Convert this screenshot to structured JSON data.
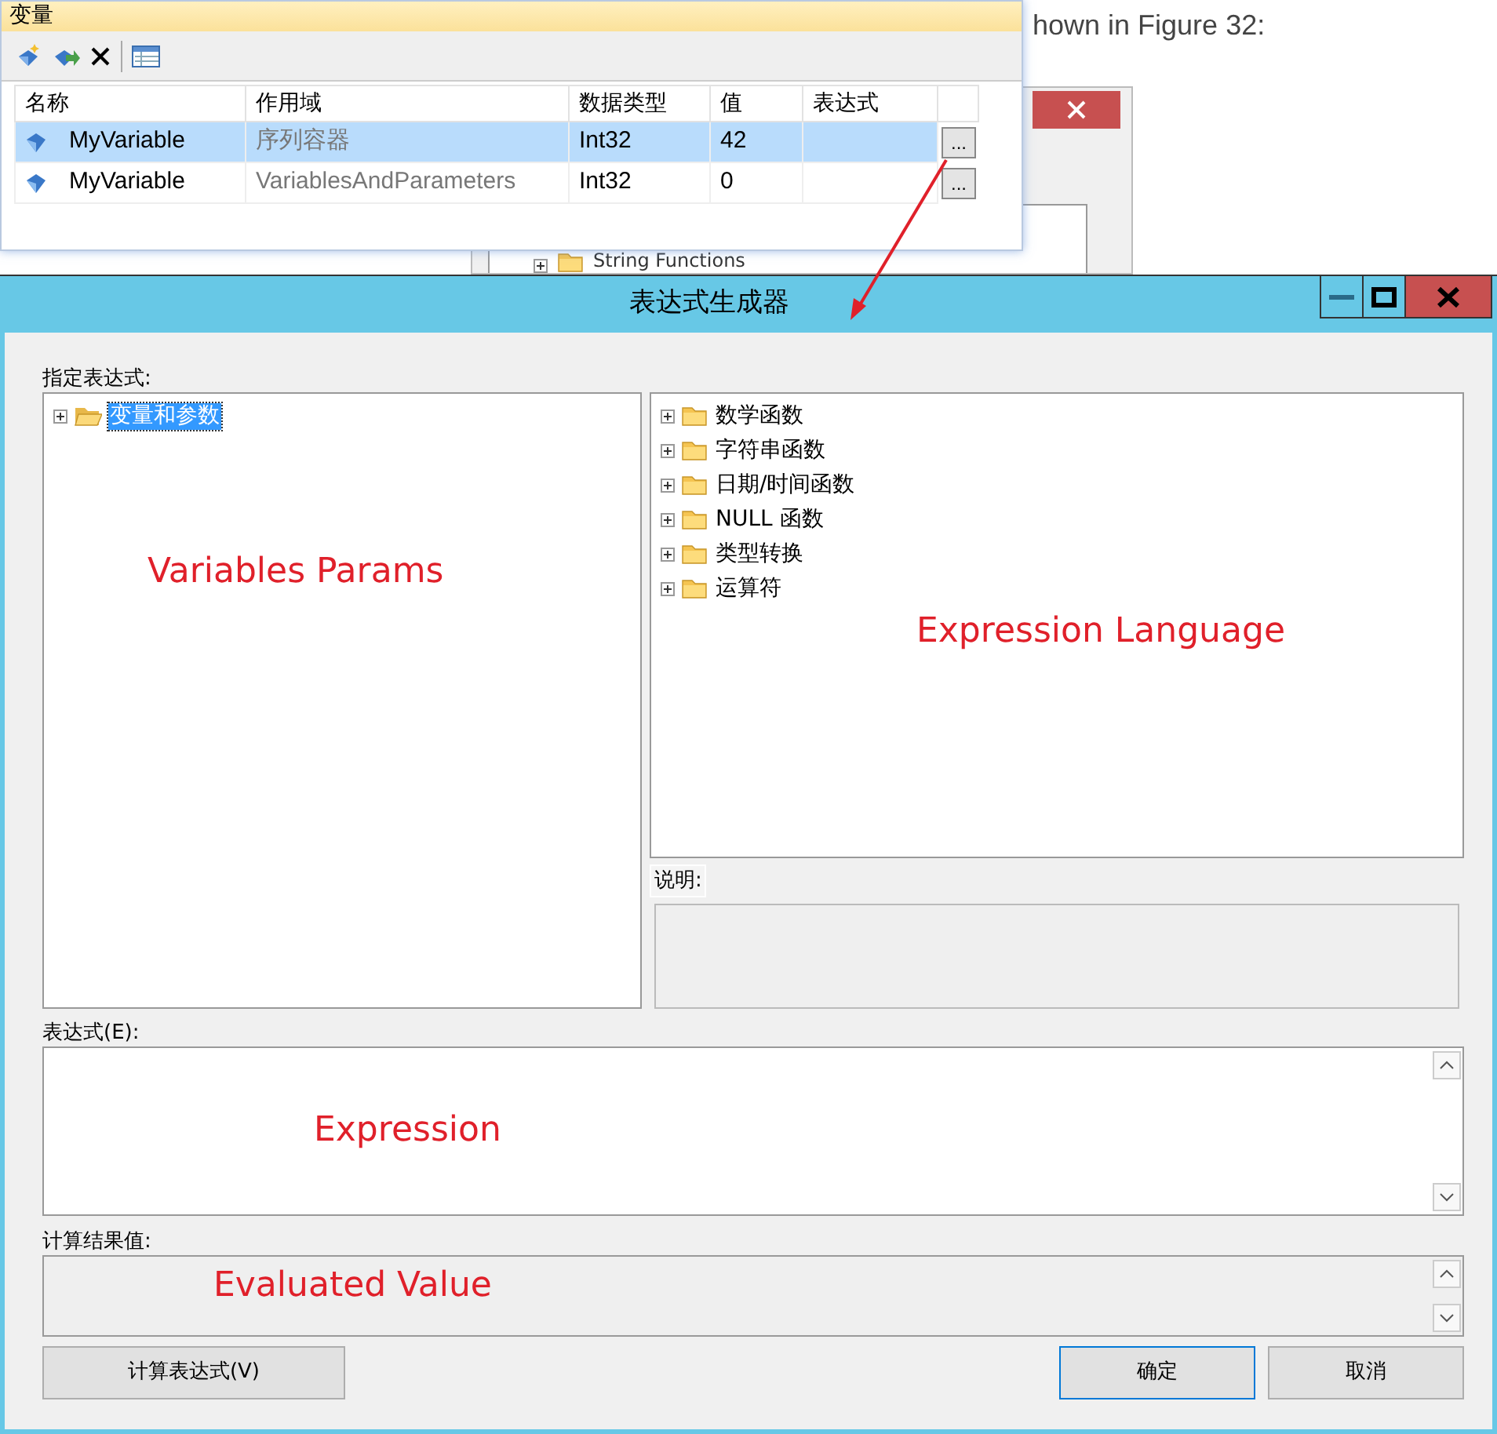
{
  "article_text": "hown in Figure 32:",
  "background_window": {
    "tree_item": "String Functions"
  },
  "variables_panel": {
    "title": "变量",
    "columns": [
      "名称",
      "作用域",
      "数据类型",
      "值",
      "表达式"
    ],
    "rows": [
      {
        "name": "MyVariable",
        "scope": "序列容器",
        "type": "Int32",
        "value": "42",
        "button": "...",
        "selected": true
      },
      {
        "name": "MyVariable",
        "scope": "VariablesAndParameters",
        "type": "Int32",
        "value": "0",
        "button": "...",
        "selected": false
      }
    ]
  },
  "dialog": {
    "title": "表达式生成器",
    "spec_label": "指定表达式:",
    "variables_tree": {
      "annotation": "Variables Params",
      "items": [
        {
          "label": "变量和参数",
          "selected": true,
          "open_folder": true
        }
      ]
    },
    "functions_tree": {
      "annotation": "Expression Language",
      "items": [
        {
          "label": "数学函数",
          "selected": false,
          "open_folder": false
        },
        {
          "label": "字符串函数",
          "selected": false,
          "open_folder": false
        },
        {
          "label": "日期/时间函数",
          "selected": false,
          "open_folder": false
        },
        {
          "label": "NULL 函数",
          "selected": false,
          "open_folder": false
        },
        {
          "label": "类型转换",
          "selected": false,
          "open_folder": false
        },
        {
          "label": "运算符",
          "selected": false,
          "open_folder": false
        }
      ]
    },
    "description_label": "说明:",
    "expression_label": "表达式(E):",
    "expression_annotation": "Expression",
    "result_label": "计算结果值:",
    "result_annotation": "Evaluated Value",
    "buttons": [
      {
        "label": "计算表达式(V)",
        "default": false
      },
      {
        "label": "确定",
        "default": true
      },
      {
        "label": "取消",
        "default": false
      }
    ]
  }
}
